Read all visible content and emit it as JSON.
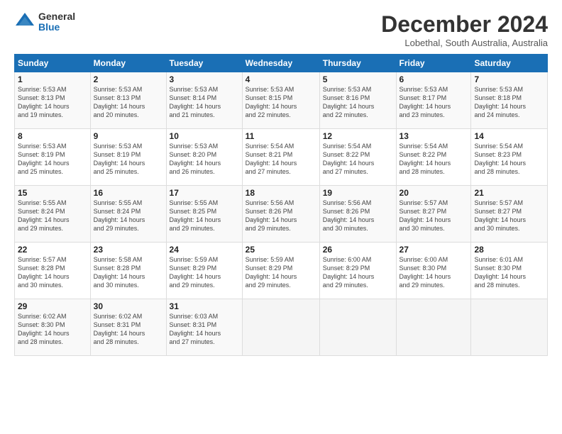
{
  "logo": {
    "general": "General",
    "blue": "Blue"
  },
  "title": "December 2024",
  "location": "Lobethal, South Australia, Australia",
  "days_of_week": [
    "Sunday",
    "Monday",
    "Tuesday",
    "Wednesday",
    "Thursday",
    "Friday",
    "Saturday"
  ],
  "weeks": [
    [
      {
        "day": "1",
        "sunrise": "5:53 AM",
        "sunset": "8:13 PM",
        "daylight": "14 hours and 19 minutes."
      },
      {
        "day": "2",
        "sunrise": "5:53 AM",
        "sunset": "8:13 PM",
        "daylight": "14 hours and 20 minutes."
      },
      {
        "day": "3",
        "sunrise": "5:53 AM",
        "sunset": "8:14 PM",
        "daylight": "14 hours and 21 minutes."
      },
      {
        "day": "4",
        "sunrise": "5:53 AM",
        "sunset": "8:15 PM",
        "daylight": "14 hours and 22 minutes."
      },
      {
        "day": "5",
        "sunrise": "5:53 AM",
        "sunset": "8:16 PM",
        "daylight": "14 hours and 22 minutes."
      },
      {
        "day": "6",
        "sunrise": "5:53 AM",
        "sunset": "8:17 PM",
        "daylight": "14 hours and 23 minutes."
      },
      {
        "day": "7",
        "sunrise": "5:53 AM",
        "sunset": "8:18 PM",
        "daylight": "14 hours and 24 minutes."
      }
    ],
    [
      {
        "day": "8",
        "sunrise": "5:53 AM",
        "sunset": "8:19 PM",
        "daylight": "14 hours and 25 minutes."
      },
      {
        "day": "9",
        "sunrise": "5:53 AM",
        "sunset": "8:19 PM",
        "daylight": "14 hours and 25 minutes."
      },
      {
        "day": "10",
        "sunrise": "5:53 AM",
        "sunset": "8:20 PM",
        "daylight": "14 hours and 26 minutes."
      },
      {
        "day": "11",
        "sunrise": "5:54 AM",
        "sunset": "8:21 PM",
        "daylight": "14 hours and 27 minutes."
      },
      {
        "day": "12",
        "sunrise": "5:54 AM",
        "sunset": "8:22 PM",
        "daylight": "14 hours and 27 minutes."
      },
      {
        "day": "13",
        "sunrise": "5:54 AM",
        "sunset": "8:22 PM",
        "daylight": "14 hours and 28 minutes."
      },
      {
        "day": "14",
        "sunrise": "5:54 AM",
        "sunset": "8:23 PM",
        "daylight": "14 hours and 28 minutes."
      }
    ],
    [
      {
        "day": "15",
        "sunrise": "5:55 AM",
        "sunset": "8:24 PM",
        "daylight": "14 hours and 29 minutes."
      },
      {
        "day": "16",
        "sunrise": "5:55 AM",
        "sunset": "8:24 PM",
        "daylight": "14 hours and 29 minutes."
      },
      {
        "day": "17",
        "sunrise": "5:55 AM",
        "sunset": "8:25 PM",
        "daylight": "14 hours and 29 minutes."
      },
      {
        "day": "18",
        "sunrise": "5:56 AM",
        "sunset": "8:26 PM",
        "daylight": "14 hours and 29 minutes."
      },
      {
        "day": "19",
        "sunrise": "5:56 AM",
        "sunset": "8:26 PM",
        "daylight": "14 hours and 30 minutes."
      },
      {
        "day": "20",
        "sunrise": "5:57 AM",
        "sunset": "8:27 PM",
        "daylight": "14 hours and 30 minutes."
      },
      {
        "day": "21",
        "sunrise": "5:57 AM",
        "sunset": "8:27 PM",
        "daylight": "14 hours and 30 minutes."
      }
    ],
    [
      {
        "day": "22",
        "sunrise": "5:57 AM",
        "sunset": "8:28 PM",
        "daylight": "14 hours and 30 minutes."
      },
      {
        "day": "23",
        "sunrise": "5:58 AM",
        "sunset": "8:28 PM",
        "daylight": "14 hours and 30 minutes."
      },
      {
        "day": "24",
        "sunrise": "5:59 AM",
        "sunset": "8:29 PM",
        "daylight": "14 hours and 29 minutes."
      },
      {
        "day": "25",
        "sunrise": "5:59 AM",
        "sunset": "8:29 PM",
        "daylight": "14 hours and 29 minutes."
      },
      {
        "day": "26",
        "sunrise": "6:00 AM",
        "sunset": "8:29 PM",
        "daylight": "14 hours and 29 minutes."
      },
      {
        "day": "27",
        "sunrise": "6:00 AM",
        "sunset": "8:30 PM",
        "daylight": "14 hours and 29 minutes."
      },
      {
        "day": "28",
        "sunrise": "6:01 AM",
        "sunset": "8:30 PM",
        "daylight": "14 hours and 28 minutes."
      }
    ],
    [
      {
        "day": "29",
        "sunrise": "6:02 AM",
        "sunset": "8:30 PM",
        "daylight": "14 hours and 28 minutes."
      },
      {
        "day": "30",
        "sunrise": "6:02 AM",
        "sunset": "8:31 PM",
        "daylight": "14 hours and 28 minutes."
      },
      {
        "day": "31",
        "sunrise": "6:03 AM",
        "sunset": "8:31 PM",
        "daylight": "14 hours and 27 minutes."
      },
      null,
      null,
      null,
      null
    ]
  ],
  "labels": {
    "sunrise": "Sunrise:",
    "sunset": "Sunset:",
    "daylight": "Daylight:"
  }
}
